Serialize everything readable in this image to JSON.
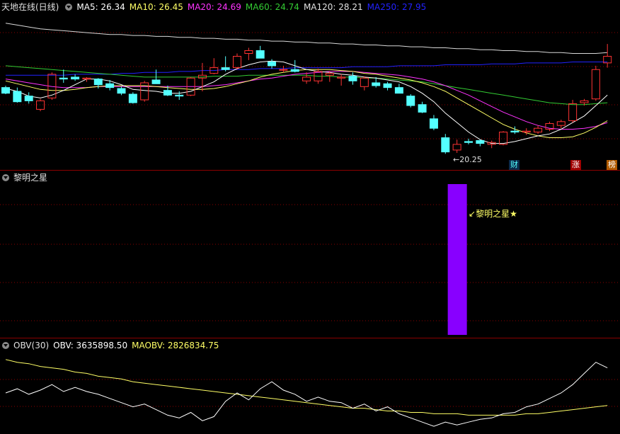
{
  "price_pane": {
    "title": "天地在线(日线)",
    "ma_labels": [
      {
        "text": "MA5: 26.34",
        "color": "#ffffff"
      },
      {
        "text": "MA10: 26.45",
        "color": "#ffff66"
      },
      {
        "text": "MA20: 24.69",
        "color": "#ff33ff"
      },
      {
        "text": "MA60: 24.74",
        "color": "#33cc33"
      },
      {
        "text": "MA120: 28.21",
        "color": "#e0e0e0"
      },
      {
        "text": "MA250: 27.95",
        "color": "#2222ff"
      }
    ],
    "low_label": "20.25",
    "tags": [
      "财",
      "涨",
      "榜"
    ]
  },
  "signal_pane": {
    "title": "黎明之星",
    "annotation": "黎明之星★",
    "bar_color": "#8800ff"
  },
  "obv_pane": {
    "title": "OBV(30)",
    "obv_label": "OBV: 3635898.50",
    "maobv_label": "MAOBV: 2826834.75"
  },
  "colors": {
    "up": "#ff3333",
    "down": "#54ffff",
    "separator": "#8b0000",
    "grid": "#8b0000"
  },
  "chart_data": {
    "type": "candlestick",
    "note_ohlc": "open, high, low, close per day",
    "ohlc": [
      [
        27.9,
        28.1,
        27.2,
        27.3
      ],
      [
        27.5,
        27.9,
        26.3,
        26.4
      ],
      [
        27.0,
        27.4,
        26.2,
        26.5
      ],
      [
        25.6,
        26.7,
        25.4,
        26.5
      ],
      [
        26.8,
        29.5,
        26.6,
        29.3
      ],
      [
        28.9,
        29.8,
        28.4,
        28.8
      ],
      [
        29.0,
        29.3,
        28.6,
        28.8
      ],
      [
        28.8,
        29.0,
        28.5,
        28.9
      ],
      [
        28.8,
        28.9,
        27.8,
        28.2
      ],
      [
        28.3,
        28.7,
        27.6,
        27.9
      ],
      [
        27.8,
        28.0,
        27.1,
        27.3
      ],
      [
        27.2,
        27.4,
        26.2,
        26.3
      ],
      [
        26.6,
        28.6,
        26.4,
        28.4
      ],
      [
        28.7,
        29.8,
        28.4,
        28.3
      ],
      [
        27.6,
        28.1,
        27.0,
        27.1
      ],
      [
        27.1,
        27.5,
        26.6,
        27.0
      ],
      [
        27.1,
        29.0,
        27.0,
        28.9
      ],
      [
        28.9,
        30.5,
        27.5,
        29.2
      ],
      [
        29.4,
        31.0,
        29.3,
        30.0
      ],
      [
        30.0,
        31.2,
        29.6,
        29.8
      ],
      [
        30.0,
        31.5,
        29.8,
        31.2
      ],
      [
        31.5,
        32.1,
        30.8,
        31.8
      ],
      [
        31.8,
        32.3,
        31.2,
        31.0
      ],
      [
        30.6,
        30.9,
        29.9,
        30.2
      ],
      [
        29.8,
        30.2,
        29.5,
        29.8
      ],
      [
        29.8,
        30.8,
        29.5,
        29.6
      ],
      [
        28.6,
        29.5,
        28.3,
        29.0
      ],
      [
        28.6,
        29.9,
        28.3,
        29.6
      ],
      [
        29.2,
        29.6,
        28.5,
        29.4
      ],
      [
        28.9,
        29.3,
        28.1,
        29.0
      ],
      [
        29.1,
        29.5,
        28.2,
        28.6
      ],
      [
        28.0,
        29.1,
        27.6,
        28.9
      ],
      [
        28.4,
        29.0,
        27.9,
        28.1
      ],
      [
        28.3,
        28.5,
        27.6,
        27.9
      ],
      [
        27.9,
        28.3,
        27.3,
        27.3
      ],
      [
        27.0,
        27.2,
        25.8,
        26.0
      ],
      [
        26.1,
        26.4,
        25.2,
        25.3
      ],
      [
        24.6,
        25.0,
        23.4,
        23.6
      ],
      [
        22.6,
        23.0,
        20.9,
        21.1
      ],
      [
        21.3,
        22.4,
        21.0,
        21.9
      ],
      [
        22.2,
        22.5,
        21.9,
        22.1
      ],
      [
        22.3,
        22.4,
        21.7,
        22.0
      ],
      [
        21.9,
        22.3,
        21.5,
        22.1
      ],
      [
        21.9,
        23.3,
        21.8,
        23.2
      ],
      [
        23.3,
        23.8,
        23.0,
        23.2
      ],
      [
        23.2,
        23.6,
        22.9,
        23.3
      ],
      [
        23.2,
        23.9,
        23.0,
        23.6
      ],
      [
        23.5,
        24.3,
        23.3,
        24.1
      ],
      [
        23.9,
        24.5,
        23.6,
        24.3
      ],
      [
        24.4,
        26.6,
        24.2,
        26.2
      ],
      [
        26.3,
        26.7,
        26.0,
        26.5
      ],
      [
        26.7,
        30.2,
        26.5,
        29.8
      ],
      [
        30.5,
        32.5,
        30.0,
        31.2
      ]
    ],
    "ma5": [
      27.8,
      27.5,
      27.0,
      26.8,
      27.1,
      27.6,
      28.2,
      28.8,
      28.8,
      28.6,
      28.2,
      27.7,
      27.6,
      27.5,
      27.3,
      27.3,
      27.5,
      28.0,
      28.5,
      29.3,
      29.9,
      30.3,
      30.6,
      30.7,
      30.6,
      30.2,
      29.8,
      29.6,
      29.5,
      29.3,
      29.2,
      29.0,
      28.9,
      28.7,
      28.5,
      28.0,
      27.3,
      26.4,
      25.2,
      24.2,
      23.2,
      22.4,
      22.0,
      22.0,
      22.2,
      22.5,
      22.8,
      23.0,
      23.5,
      24.2,
      24.9,
      26.0,
      27.1
    ],
    "ma10": [
      28.6,
      28.3,
      28.0,
      27.7,
      27.6,
      27.6,
      27.7,
      27.9,
      28.0,
      28.1,
      28.1,
      28.1,
      28.1,
      28.0,
      27.9,
      27.8,
      27.7,
      27.7,
      27.8,
      28.0,
      28.3,
      28.6,
      29.0,
      29.3,
      29.5,
      29.7,
      29.8,
      29.8,
      29.8,
      29.7,
      29.6,
      29.4,
      29.3,
      29.1,
      28.9,
      28.7,
      28.4,
      28.0,
      27.5,
      26.8,
      26.1,
      25.4,
      24.7,
      24.0,
      23.5,
      23.1,
      22.8,
      22.6,
      22.6,
      22.7,
      23.1,
      23.7,
      24.4
    ],
    "ma20": [
      28.8,
      28.6,
      28.4,
      28.2,
      28.0,
      27.9,
      27.9,
      27.9,
      28.0,
      28.0,
      28.0,
      28.0,
      28.0,
      28.0,
      28.0,
      28.0,
      28.0,
      28.0,
      28.1,
      28.2,
      28.4,
      28.6,
      28.8,
      28.9,
      29.1,
      29.3,
      29.4,
      29.5,
      29.6,
      29.6,
      29.6,
      29.5,
      29.4,
      29.3,
      29.2,
      29.0,
      28.8,
      28.5,
      28.1,
      27.6,
      27.1,
      26.5,
      25.9,
      25.3,
      24.8,
      24.3,
      23.9,
      23.6,
      23.5,
      23.5,
      23.6,
      23.8,
      24.2
    ],
    "ma60": [
      30.2,
      30.1,
      30.0,
      29.9,
      29.8,
      29.7,
      29.6,
      29.5,
      29.4,
      29.3,
      29.2,
      29.1,
      29.0,
      29.0,
      29.0,
      29.0,
      29.0,
      29.0,
      29.1,
      29.1,
      29.1,
      29.2,
      29.2,
      29.2,
      29.2,
      29.2,
      29.2,
      29.1,
      29.1,
      29.0,
      29.0,
      28.9,
      28.9,
      28.8,
      28.7,
      28.6,
      28.5,
      28.3,
      28.1,
      27.9,
      27.7,
      27.5,
      27.3,
      27.1,
      26.9,
      26.7,
      26.5,
      26.3,
      26.2,
      26.1,
      26.1,
      26.2,
      26.3
    ],
    "ma120": [
      34.7,
      34.5,
      34.3,
      34.1,
      34.0,
      33.9,
      33.8,
      33.7,
      33.6,
      33.5,
      33.5,
      33.4,
      33.4,
      33.3,
      33.3,
      33.2,
      33.2,
      33.1,
      33.1,
      33.0,
      33.0,
      32.9,
      32.9,
      32.8,
      32.8,
      32.7,
      32.7,
      32.6,
      32.6,
      32.5,
      32.5,
      32.4,
      32.4,
      32.3,
      32.3,
      32.2,
      32.2,
      32.1,
      32.1,
      32.0,
      32.0,
      31.9,
      31.9,
      31.8,
      31.8,
      31.7,
      31.7,
      31.6,
      31.6,
      31.5,
      31.5,
      31.5,
      31.6
    ],
    "ma250": [
      29.2,
      29.2,
      29.2,
      29.2,
      29.2,
      29.2,
      29.3,
      29.3,
      29.3,
      29.3,
      29.4,
      29.4,
      29.5,
      29.5,
      29.5,
      29.6,
      29.6,
      29.7,
      29.7,
      29.8,
      29.8,
      29.8,
      29.9,
      29.9,
      29.9,
      30.0,
      30.0,
      30.0,
      30.0,
      30.0,
      30.1,
      30.1,
      30.1,
      30.1,
      30.2,
      30.2,
      30.2,
      30.2,
      30.3,
      30.3,
      30.3,
      30.3,
      30.4,
      30.4,
      30.4,
      30.5,
      30.5,
      30.5,
      30.5,
      30.6,
      30.6,
      30.6,
      30.6
    ],
    "y_range": [
      19.5,
      35.5
    ],
    "signal_day_index": 39,
    "obv": [
      18.6,
      18.9,
      18.5,
      18.8,
      19.2,
      18.7,
      19.0,
      18.7,
      18.5,
      18.2,
      17.9,
      17.6,
      17.8,
      17.4,
      17.0,
      16.8,
      17.2,
      16.6,
      16.9,
      18.0,
      18.6,
      18.1,
      18.9,
      19.4,
      18.8,
      18.5,
      18.0,
      18.3,
      18.0,
      17.9,
      17.5,
      17.8,
      17.3,
      17.6,
      17.1,
      16.8,
      16.5,
      16.2,
      16.5,
      16.3,
      16.5,
      16.7,
      16.8,
      17.1,
      17.2,
      17.6,
      17.8,
      18.2,
      18.6,
      19.2,
      20.0,
      20.8,
      20.4
    ],
    "maobv": [
      21.0,
      20.8,
      20.7,
      20.5,
      20.4,
      20.3,
      20.1,
      20.0,
      19.8,
      19.7,
      19.6,
      19.4,
      19.3,
      19.2,
      19.1,
      19.0,
      18.9,
      18.8,
      18.7,
      18.6,
      18.5,
      18.4,
      18.3,
      18.2,
      18.1,
      18.0,
      17.9,
      17.8,
      17.7,
      17.6,
      17.5,
      17.5,
      17.4,
      17.3,
      17.3,
      17.2,
      17.2,
      17.1,
      17.1,
      17.1,
      17.0,
      17.0,
      17.0,
      17.0,
      17.0,
      17.1,
      17.1,
      17.2,
      17.3,
      17.4,
      17.5,
      17.6,
      17.7
    ],
    "obv_range": [
      15.8,
      21.6
    ]
  }
}
